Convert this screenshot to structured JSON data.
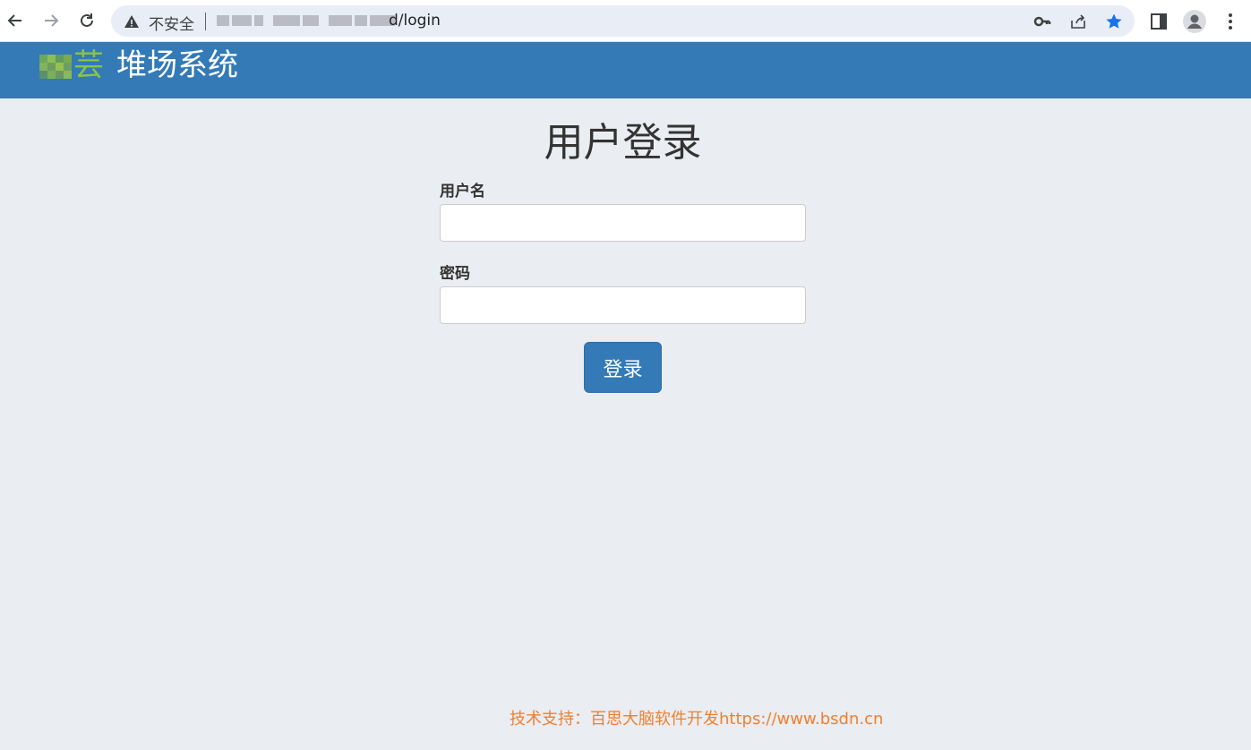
{
  "browser": {
    "security_label": "不安全",
    "url_visible": "d/login"
  },
  "header": {
    "logo_char": "芸",
    "title": "堆场系统"
  },
  "login": {
    "title": "用户登录",
    "username_label": "用户名",
    "username_value": "",
    "password_label": "密码",
    "password_value": "",
    "submit_label": "登录"
  },
  "footer": {
    "text": "技术支持：百思大脑软件开发https://www.bsdn.cn"
  },
  "colors": {
    "header_bg": "#337ab7",
    "page_bg": "#eaedf2",
    "button_bg": "#337ab7",
    "footer_text": "#f0802f",
    "logo_green": "#8bc34a"
  }
}
